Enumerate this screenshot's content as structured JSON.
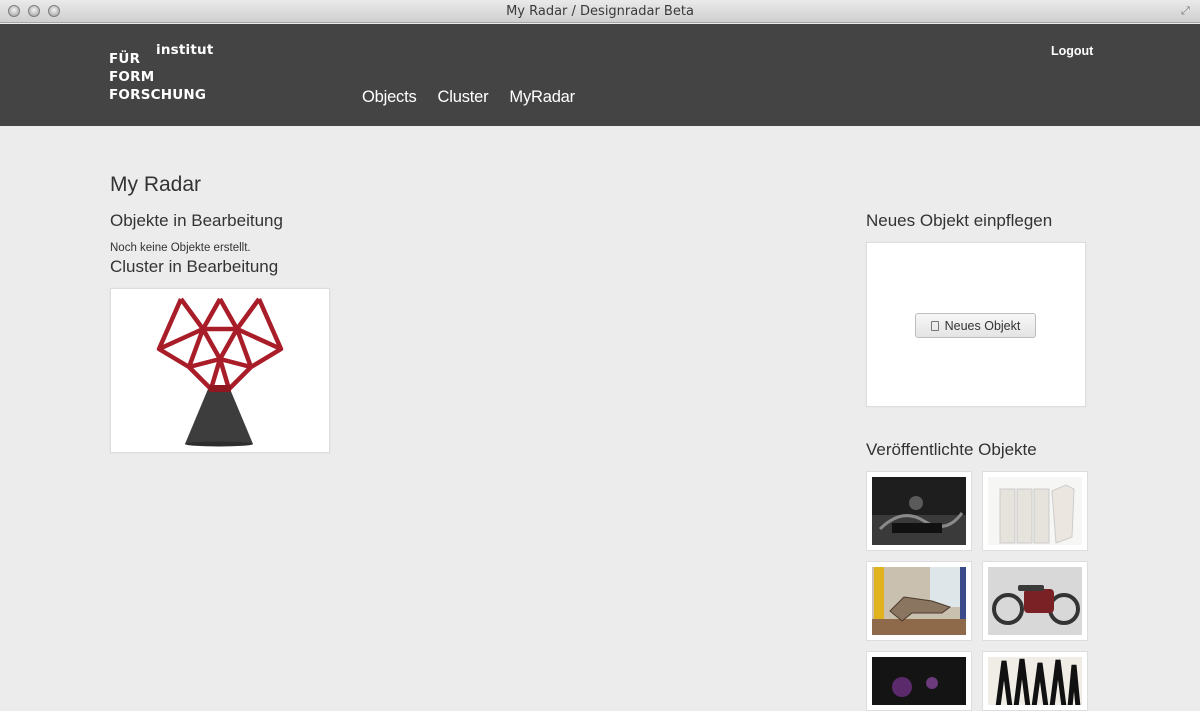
{
  "window": {
    "title": "My Radar / Designradar Beta"
  },
  "header": {
    "logo_lines": [
      "institut",
      "FÜR",
      "FORM",
      "FORSCHUNG"
    ],
    "nav": [
      "Objects",
      "Cluster",
      "MyRadar"
    ],
    "logout_label": "Logout"
  },
  "main": {
    "page_title": "My Radar",
    "objects_heading": "Objekte in Bearbeitung",
    "objects_empty_text": "Noch keine Objekte erstellt.",
    "cluster_heading": "Cluster in Bearbeitung"
  },
  "sidebar": {
    "new_object_heading": "Neues Objekt einpflegen",
    "new_object_button": "Neues Objekt",
    "published_heading": "Veröffentlichte Objekte"
  },
  "colors": {
    "header_bg": "#444444",
    "page_bg": "#ececec",
    "chair_red": "#b01e2a"
  }
}
